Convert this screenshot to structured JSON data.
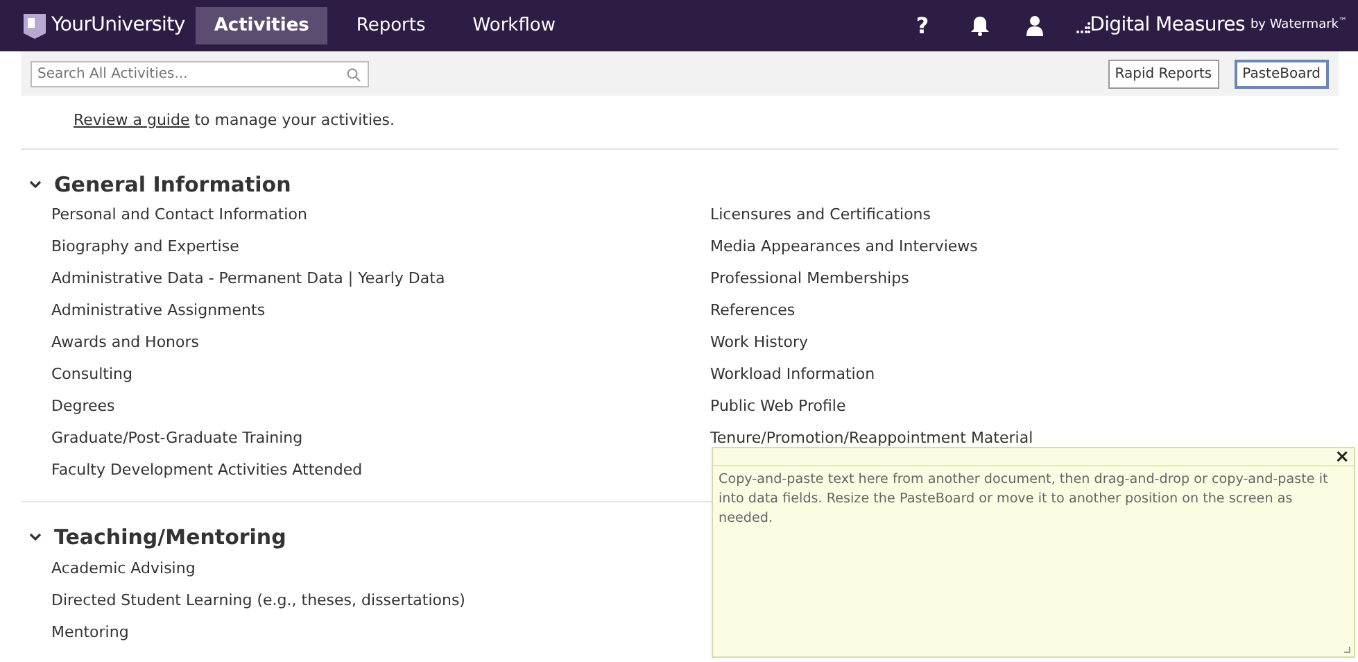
{
  "navbar": {
    "brand": "YourUniversity",
    "tabs": [
      {
        "label": "Activities",
        "selected": true
      },
      {
        "label": "Reports",
        "selected": false
      },
      {
        "label": "Workflow",
        "selected": false
      }
    ],
    "help": "?",
    "vendor": "Digital Measures",
    "vendor_by": "by Watermark",
    "vendor_tm": "™"
  },
  "toolbar": {
    "search": {
      "placeholder": "Search All Activities..."
    },
    "buttons": [
      {
        "label": "Rapid Reports",
        "active": false
      },
      {
        "label": "PasteBoard",
        "active": true
      }
    ]
  },
  "guide": {
    "link": "Review a guide",
    "text": " to manage your activities."
  },
  "sections": [
    {
      "title": "General Information",
      "expanded": true,
      "left": [
        "Personal and Contact Information",
        "Biography and Expertise",
        "Administrative Data - Permanent Data | Yearly Data",
        "Administrative Assignments",
        "Awards and Honors",
        "Consulting",
        "Degrees",
        "Graduate/Post-Graduate Training",
        "Faculty Development Activities Attended"
      ],
      "right": [
        "Licensures and Certifications",
        "Media Appearances and Interviews",
        "Professional Memberships",
        "References",
        "Work History",
        "Workload Information",
        "Public Web Profile",
        "Tenure/Promotion/Reappointment Material"
      ]
    },
    {
      "title": "Teaching/Mentoring",
      "expanded": true,
      "left": [
        "Academic Advising",
        "Directed Student Learning (e.g., theses, dissertations)",
        "Mentoring"
      ]
    }
  ],
  "pasteboard": {
    "close": "×",
    "text": "Copy-and-paste text here from another document, then drag-and-drop or copy-and-paste it into data fields. Resize the PasteBoard or move it to another position on the screen as needed."
  }
}
